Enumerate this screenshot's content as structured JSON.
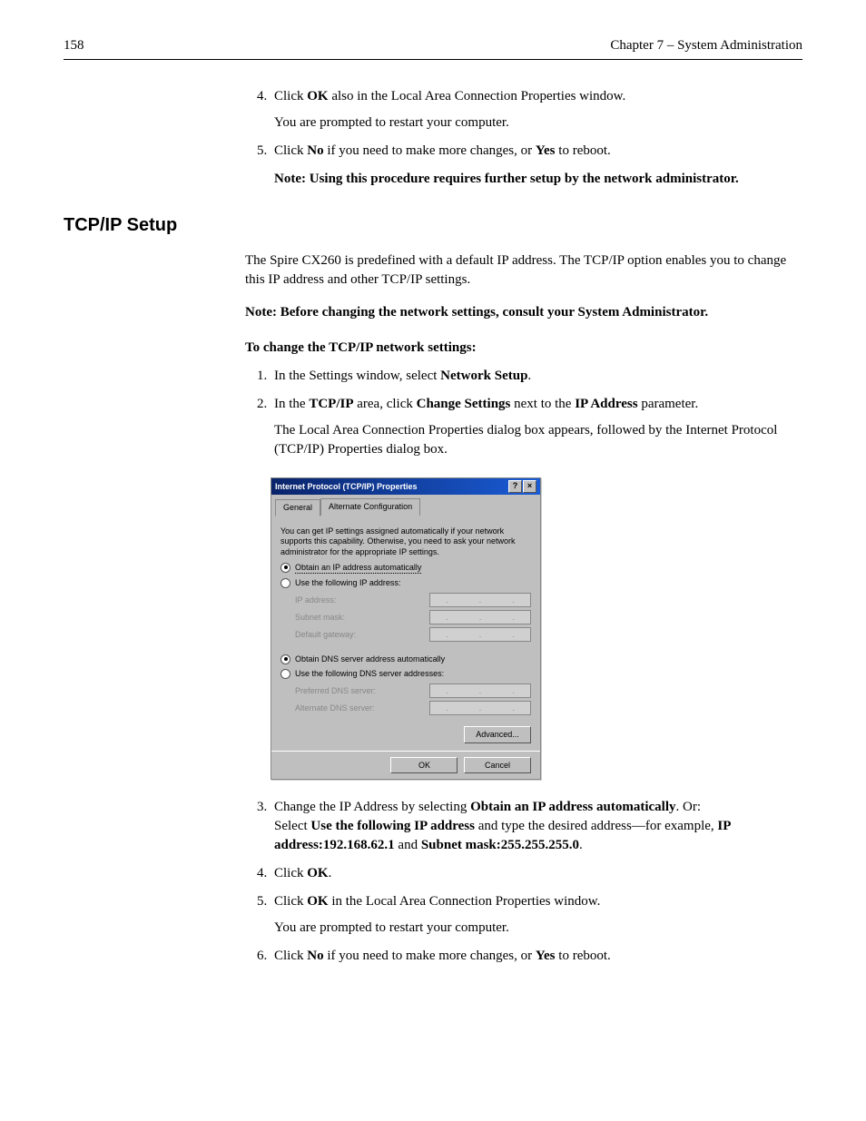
{
  "header": {
    "pageNumber": "158",
    "chapter": "Chapter 7 – System Administration"
  },
  "topList": {
    "item4": {
      "pre": "Click ",
      "bold": "OK",
      "post": " also in the Local Area Connection Properties window.",
      "sub": "You are prompted to restart your computer."
    },
    "item5": {
      "pre": "Click ",
      "bold1": "No",
      "mid": " if you need to make more changes, or ",
      "bold2": "Yes",
      "post": " to reboot.",
      "noteLabel": "Note:",
      "noteText": " Using this procedure requires further setup by the network administrator."
    }
  },
  "section": {
    "heading": "TCP/IP Setup",
    "intro": "The Spire CX260 is predefined with a default IP address. The TCP/IP option enables you to change this IP address and other TCP/IP settings.",
    "noteLabel": "Note:",
    "noteText": " Before changing the network settings, consult your System Administrator.",
    "subHeading": "To change the TCP/IP network settings:"
  },
  "steps": {
    "s1": {
      "pre": "In the Settings window, select ",
      "bold": "Network Setup",
      "post": "."
    },
    "s2": {
      "pre": "In the ",
      "b1": "TCP/IP",
      "mid1": " area, click ",
      "b2": "Change Settings",
      "mid2": " next to the ",
      "b3": "IP Address",
      "post": " parameter.",
      "sub": "The Local Area Connection Properties dialog box appears, followed by the Internet Protocol (TCP/IP) Properties dialog box."
    },
    "s3": {
      "pre": "Change the IP Address by selecting ",
      "b1": "Obtain an IP address automatically",
      "mid1": ". Or:",
      "line2pre": "Select ",
      "b2": "Use the following IP address",
      "line2mid": " and type the desired address—for example, ",
      "b3": "IP address:192.168.62.1",
      "line2mid2": " and ",
      "b4": "Subnet mask:255.255.255.0",
      "post": "."
    },
    "s4": {
      "pre": "Click ",
      "bold": "OK",
      "post": "."
    },
    "s5": {
      "pre": "Click ",
      "bold": "OK",
      "post": " in the Local Area Connection Properties window.",
      "sub": "You are prompted to restart your computer."
    },
    "s6": {
      "pre": "Click ",
      "b1": "No",
      "mid": " if you need to make more changes, or ",
      "b2": "Yes",
      "post": " to reboot."
    }
  },
  "dialog": {
    "title": "Internet Protocol (TCP/IP) Properties",
    "help": "?",
    "close": "×",
    "tabGeneral": "General",
    "tabAlternate": "Alternate Configuration",
    "description": "You can get IP settings assigned automatically if your network supports this capability. Otherwise, you need to ask your network administrator for the appropriate IP settings.",
    "radioObtainIP": "Obtain an IP address automatically",
    "radioUseIP": "Use the following IP address:",
    "labelIP": "IP address:",
    "labelSubnet": "Subnet mask:",
    "labelGateway": "Default gateway:",
    "radioObtainDNS": "Obtain DNS server address automatically",
    "radioUseDNS": "Use the following DNS server addresses:",
    "labelPreferredDNS": "Preferred DNS server:",
    "labelAlternateDNS": "Alternate DNS server:",
    "advanced": "Advanced...",
    "ok": "OK",
    "cancel": "Cancel"
  }
}
